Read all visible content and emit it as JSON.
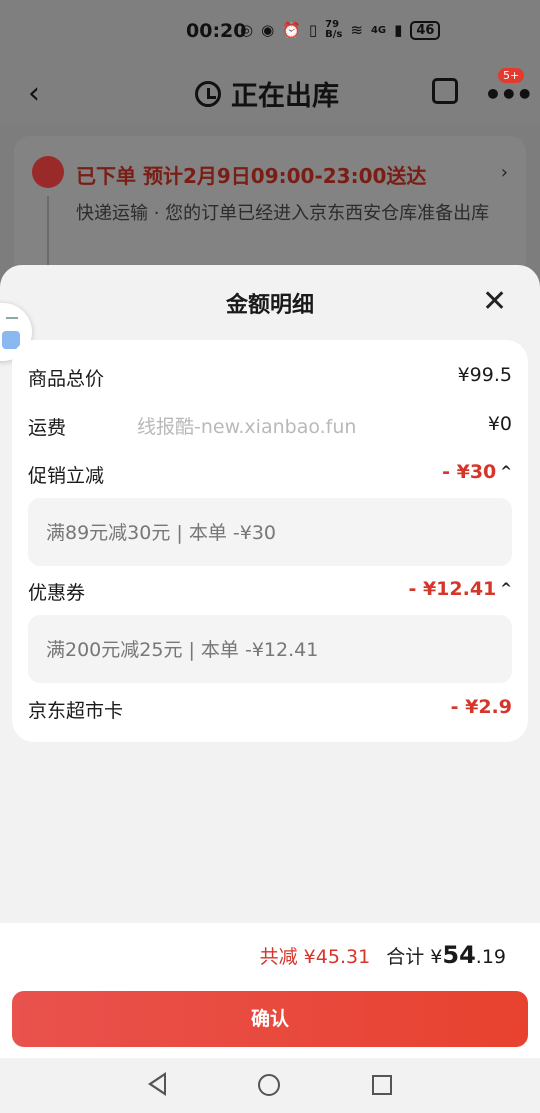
{
  "status_bar": {
    "time": "00:20",
    "speed_top": "79",
    "speed_unit": "B/s",
    "network": "4G",
    "battery": "46"
  },
  "header": {
    "title": "正在出库",
    "badge": "5+"
  },
  "order_status": {
    "headline": "已下单 预计2月9日09:00-23:00送达",
    "detail": "快递运输 · 您的订单已经进入京东西安仓库准备出库"
  },
  "sheet": {
    "title": "金额明细",
    "watermark": "线报酷-new.xianbao.fun",
    "rows": [
      {
        "label": "商品总价",
        "value": "¥99.5"
      },
      {
        "label": "运费",
        "value": "¥0"
      },
      {
        "label": "促销立减",
        "value": "- ¥30",
        "sub": "满89元减30元 | 本单 -¥30"
      },
      {
        "label": "优惠券",
        "value": "- ¥12.41",
        "sub": "满200元减25元 | 本单 -¥12.41"
      },
      {
        "label": "京东超市卡",
        "value": "- ¥2.9"
      }
    ]
  },
  "footer": {
    "reduce": "共减 ¥45.31",
    "total_label": "合计",
    "total_currency": "¥",
    "total_int": "54",
    "total_dec": ".19",
    "confirm_label": "确认"
  },
  "colors": {
    "accent_red": "#d6352a",
    "button_red": "#e8422f"
  }
}
